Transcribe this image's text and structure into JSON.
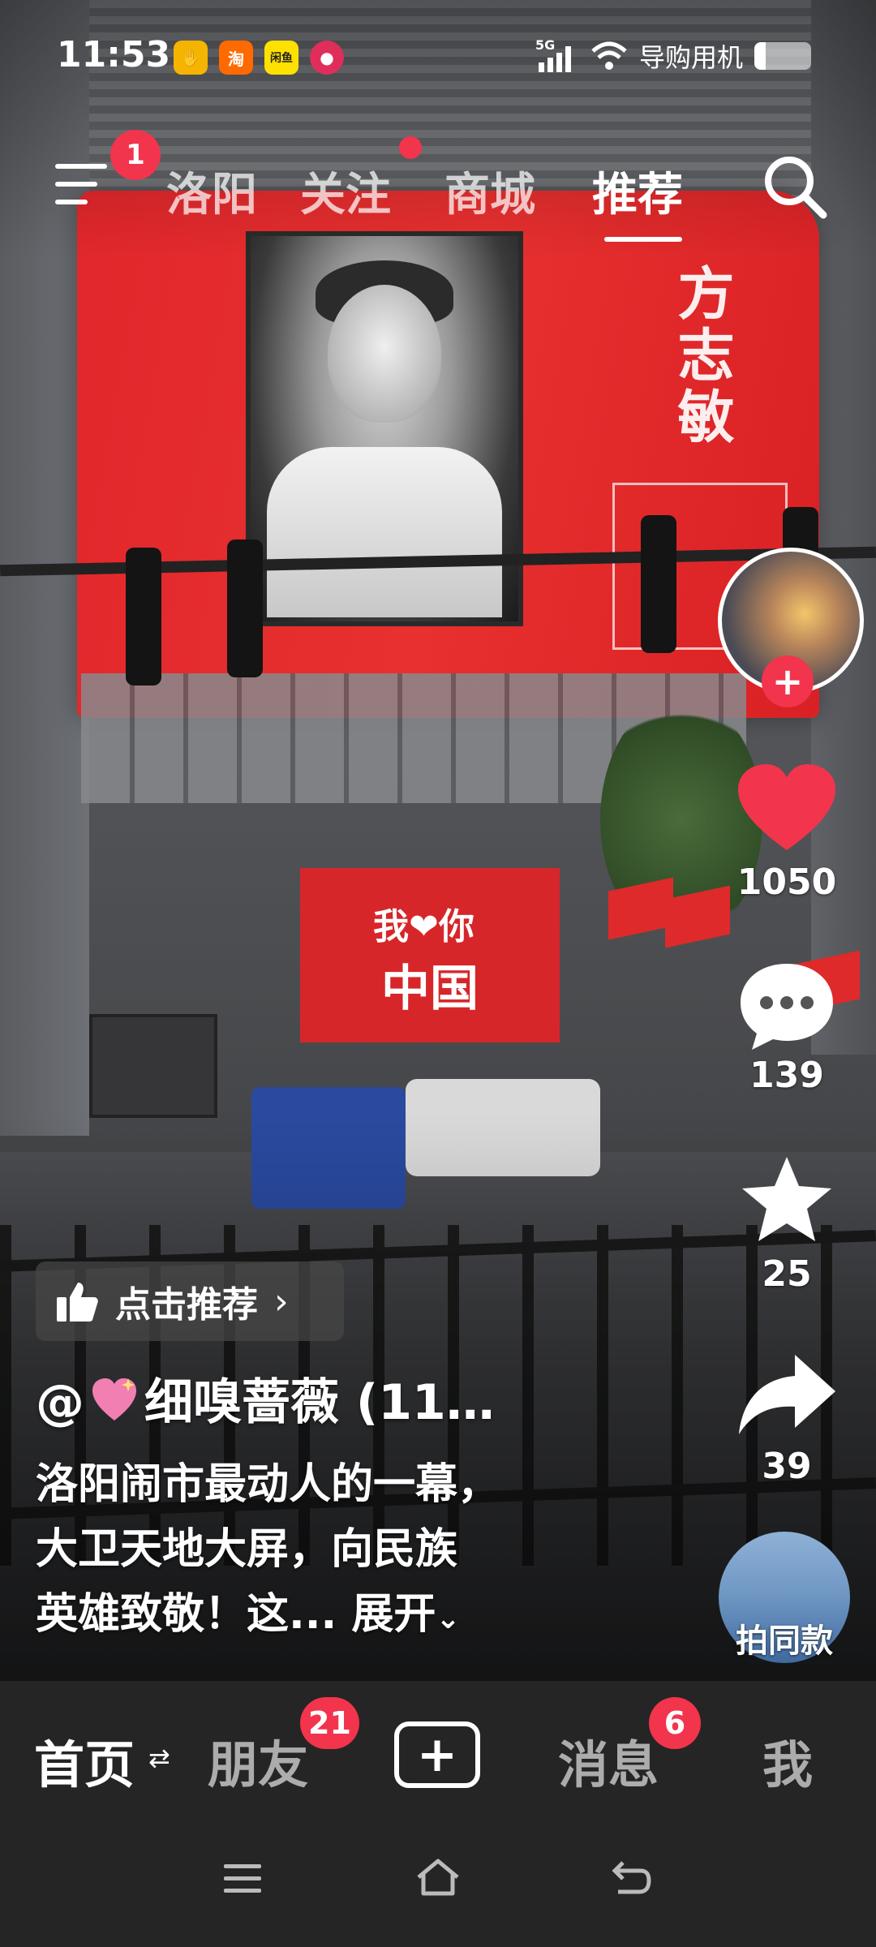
{
  "status_bar": {
    "time": "11:53",
    "app_icons": [
      {
        "name": "hand-app-icon",
        "glyph": "✋",
        "color": "#f5b400"
      },
      {
        "name": "taobao-icon",
        "label": "淘",
        "color": "#ff6a00"
      },
      {
        "name": "shopping-app-icon",
        "label": "闲鱼",
        "color": "#ffe100"
      },
      {
        "name": "pinduoduo-icon",
        "glyph": "●",
        "color": "#e02e5b"
      }
    ],
    "network": "5G",
    "mode_label": "导购用机"
  },
  "top_nav": {
    "menu_badge": "1",
    "tabs": [
      {
        "label": "洛阳",
        "active": false
      },
      {
        "label": "关注",
        "active": false,
        "dot": true
      },
      {
        "label": "商城",
        "active": false
      },
      {
        "label": "推荐",
        "active": true
      }
    ]
  },
  "billboard": {
    "title": "方志敏",
    "sign_line1": "我❤你",
    "sign_line2": "中国"
  },
  "side_actions": {
    "like_count": "1050",
    "comment_count": "139",
    "favorite_count": "25",
    "share_count": "39",
    "remix_label": "拍同款"
  },
  "video_info": {
    "recommend_label": "点击推荐",
    "author": "细嗅蔷薇 (11…",
    "caption_lines": [
      "洛阳闹市最动人的一幕，",
      "大卫天地大屏，向民族",
      "英雄致敬！这..."
    ],
    "expand_label": "展开"
  },
  "bottom_nav": {
    "items": [
      {
        "label": "首页",
        "active": true
      },
      {
        "label": "朋友",
        "badge": "21"
      },
      {
        "label": "消息",
        "badge": "6"
      },
      {
        "label": "我"
      }
    ]
  },
  "colors": {
    "accent": "#f2344d",
    "bar_bg": "#252525",
    "billboard_red": "#e2272c"
  }
}
